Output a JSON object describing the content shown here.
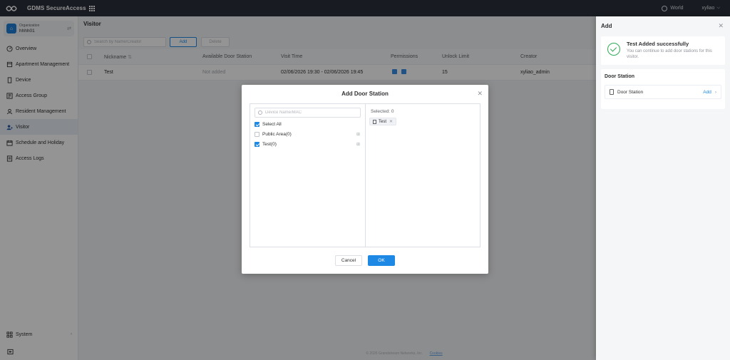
{
  "topbar": {
    "app_title": "GDMS SecureAccess",
    "region": "World",
    "user": "xyliao"
  },
  "sidebar": {
    "org_label": "Organization",
    "org_name": "hhhh01",
    "items": [
      {
        "label": "Overview",
        "icon": "overview-icon"
      },
      {
        "label": "Apartment Management",
        "icon": "apartment-icon"
      },
      {
        "label": "Device",
        "icon": "device-icon"
      },
      {
        "label": "Access Group",
        "icon": "access-group-icon"
      },
      {
        "label": "Resident Management",
        "icon": "resident-icon"
      },
      {
        "label": "Visitor",
        "icon": "visitor-icon",
        "active": true
      },
      {
        "label": "Schedule and Holiday",
        "icon": "calendar-icon"
      },
      {
        "label": "Access Logs",
        "icon": "logs-icon"
      }
    ],
    "system_label": "System"
  },
  "main": {
    "title": "Visitor",
    "search_placeholder": "Search by Name/Creator",
    "add_label": "Add",
    "delete_label": "Delete",
    "columns": [
      "Nickname",
      "Available Door Station",
      "Visit Time",
      "Permissions",
      "Unlock Limit",
      "Creator"
    ],
    "sort_indicator": "⇅",
    "rows": [
      {
        "nickname": "Test",
        "door_station": "Not added",
        "visit_time": "02/06/2026 19:30 - 02/06/2026 19:45",
        "unlock_limit": "15",
        "creator": "xyliao_admin"
      }
    ],
    "footer_text": "© 2026 Grandstream Networks, Inc.",
    "footer_link": "Cookies"
  },
  "drawer": {
    "title": "Add",
    "success_title": "Test Added successfully",
    "success_desc": "You can continue to add door stations for this visitor.",
    "section_title": "Door Station",
    "row_label": "Door Station",
    "row_action": "Add"
  },
  "modal": {
    "title": "Add Door Station",
    "search_placeholder": "Device Name/MAC",
    "select_all": "Select All",
    "tree": [
      {
        "label": "Public Area(0)",
        "checked": false
      },
      {
        "label": "Test(0)",
        "checked": true
      }
    ],
    "selected_label": "Selected: 0",
    "tag_label": "Test",
    "cancel_label": "Cancel",
    "ok_label": "OK"
  },
  "colors": {
    "accent": "#1e88e5",
    "topbar": "#2a2f3a",
    "success": "#2eaa55"
  }
}
